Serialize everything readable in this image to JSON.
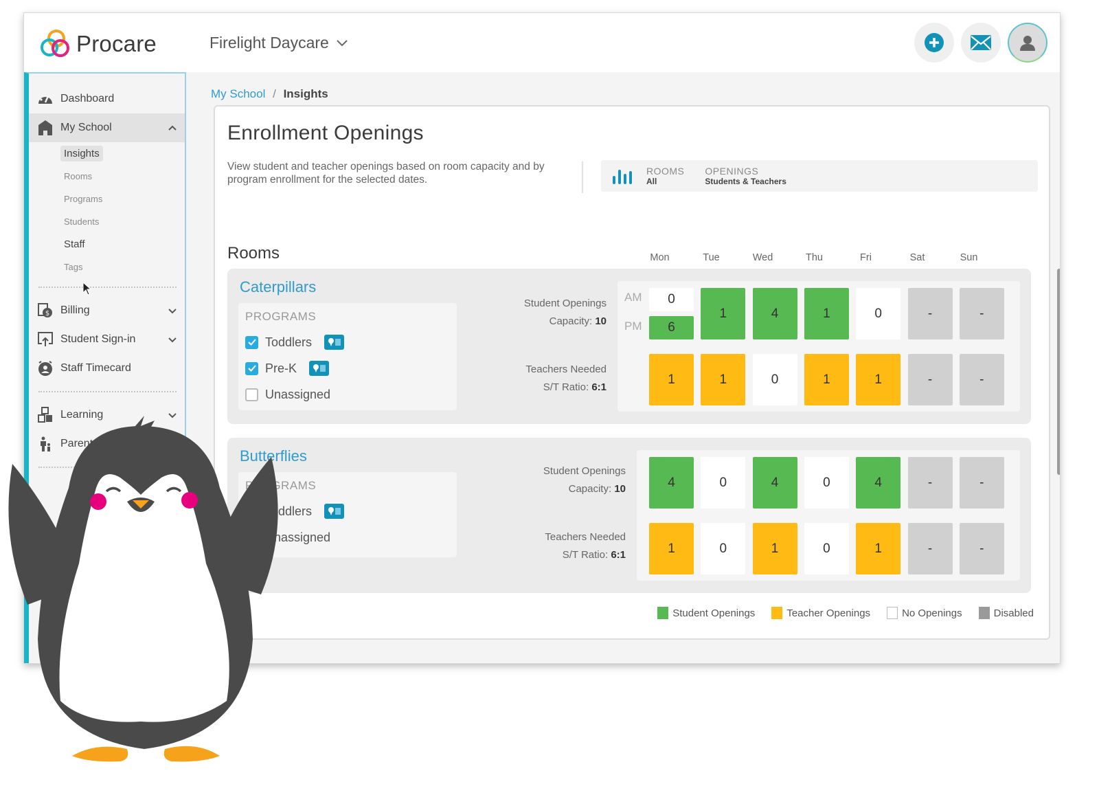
{
  "app": {
    "brand": "Procare",
    "school_selector": "Firelight Daycare"
  },
  "top_actions": [
    {
      "icon": "plus-circle-icon",
      "label": "Add"
    },
    {
      "icon": "mail-icon",
      "label": "Messages"
    },
    {
      "icon": "user-avatar-icon",
      "label": "Profile"
    }
  ],
  "sidebar": {
    "items": [
      {
        "label": "Dashboard",
        "icon": "dashboard-icon"
      },
      {
        "label": "My School",
        "icon": "school-icon",
        "expanded": true
      },
      {
        "label": "Billing",
        "icon": "billing-icon"
      },
      {
        "label": "Student Sign-in",
        "icon": "sign-in-icon"
      },
      {
        "label": "Staff Timecard",
        "icon": "timecard-icon"
      },
      {
        "label": "Learning",
        "icon": "learning-icon"
      },
      {
        "label": "Parent",
        "icon": "parent-icon"
      }
    ],
    "my_school_sub": [
      "Insights",
      "Rooms",
      "Programs",
      "Students",
      "Staff",
      "Tags"
    ]
  },
  "breadcrumb": {
    "parent": "My School",
    "separator": "/",
    "current": "Insights"
  },
  "page": {
    "title": "Enrollment Openings",
    "description": "View student and teacher openings based on room capacity and by program enrollment for the selected dates.",
    "filters": {
      "rooms_label": "ROOMS",
      "rooms_value": "All",
      "openings_label": "OPENINGS",
      "openings_value": "Students & Teachers"
    },
    "rooms_heading": "Rooms",
    "days": [
      "Mon",
      "Tue",
      "Wed",
      "Thu",
      "Fri",
      "Sat",
      "Sun"
    ],
    "am_label": "AM",
    "pm_label": "PM",
    "programs_label": "PROGRAMS"
  },
  "rooms": [
    {
      "name": "Caterpillars",
      "programs": [
        {
          "label": "Toddlers",
          "checked": true,
          "badge": true
        },
        {
          "label": "Pre-K",
          "checked": true,
          "badge": true
        },
        {
          "label": "Unassigned",
          "checked": false,
          "badge": false
        }
      ],
      "student_label": "Student Openings",
      "capacity_label": "Capacity:",
      "capacity": "10",
      "teacher_label": "Teachers Needed",
      "ratio_label": "S/T Ratio:",
      "ratio": "6:1",
      "student_openings": [
        {
          "am": "0",
          "am_status": "none",
          "pm": "6",
          "pm_status": "student"
        },
        {
          "value": "1",
          "status": "student"
        },
        {
          "value": "4",
          "status": "student"
        },
        {
          "value": "1",
          "status": "student"
        },
        {
          "value": "0",
          "status": "none"
        },
        {
          "value": "-",
          "status": "disabled"
        },
        {
          "value": "-",
          "status": "disabled"
        }
      ],
      "teacher_openings": [
        {
          "value": "1",
          "status": "teacher"
        },
        {
          "value": "1",
          "status": "teacher"
        },
        {
          "value": "0",
          "status": "none"
        },
        {
          "value": "1",
          "status": "teacher"
        },
        {
          "value": "1",
          "status": "teacher"
        },
        {
          "value": "-",
          "status": "disabled"
        },
        {
          "value": "-",
          "status": "disabled"
        }
      ]
    },
    {
      "name": "Butterflies",
      "programs": [
        {
          "label": "Toddlers",
          "checked": true,
          "badge": true
        },
        {
          "label": "Unassigned",
          "checked": false,
          "badge": false
        }
      ],
      "student_label": "Student Openings",
      "capacity_label": "Capacity:",
      "capacity": "10",
      "teacher_label": "Teachers Needed",
      "ratio_label": "S/T Ratio:",
      "ratio": "6:1",
      "student_openings": [
        {
          "value": "4",
          "status": "student"
        },
        {
          "value": "0",
          "status": "none"
        },
        {
          "value": "4",
          "status": "student"
        },
        {
          "value": "0",
          "status": "none"
        },
        {
          "value": "4",
          "status": "student"
        },
        {
          "value": "-",
          "status": "disabled"
        },
        {
          "value": "-",
          "status": "disabled"
        }
      ],
      "teacher_openings": [
        {
          "value": "1",
          "status": "teacher"
        },
        {
          "value": "0",
          "status": "none"
        },
        {
          "value": "1",
          "status": "teacher"
        },
        {
          "value": "0",
          "status": "none"
        },
        {
          "value": "1",
          "status": "teacher"
        },
        {
          "value": "-",
          "status": "disabled"
        },
        {
          "value": "-",
          "status": "disabled"
        }
      ]
    }
  ],
  "legend": [
    {
      "label": "Student Openings",
      "color": "#57b952"
    },
    {
      "label": "Teacher Openings",
      "color": "#ffbb14"
    },
    {
      "label": "No Openings",
      "color": "#ffffff"
    },
    {
      "label": "Disabled",
      "color": "#9a9a9a"
    }
  ],
  "colors": {
    "accent": "#2e9ccd",
    "sidebar_stripe": "#16b5c8",
    "student": "#57b952",
    "teacher": "#ffbb14",
    "none": "#ffffff",
    "disabled": "#d0d0d0",
    "penguin_body": "#4a4a4a",
    "penguin_cheek": "#e6007e",
    "penguin_beak": "#f7a21b"
  }
}
